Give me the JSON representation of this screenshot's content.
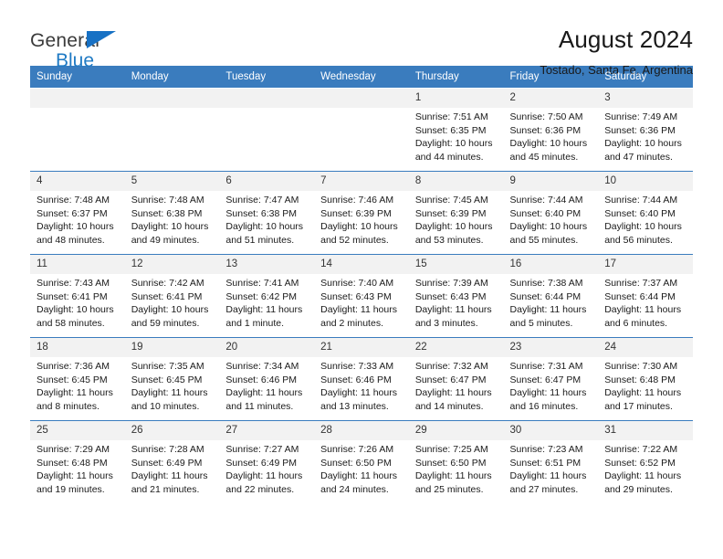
{
  "brand": {
    "name_top": "General",
    "name_bottom": "Blue",
    "triangle_color": "#1771c4",
    "text_color": "#3b3b3b",
    "blue_color": "#1f7ac4"
  },
  "header": {
    "title": "August 2024",
    "subtitle": "Tostado, Santa Fe, Argentina"
  },
  "calendar": {
    "header_bg": "#3a7cbe",
    "daynum_bg": "#f2f2f2",
    "weekdays": [
      "Sunday",
      "Monday",
      "Tuesday",
      "Wednesday",
      "Thursday",
      "Friday",
      "Saturday"
    ],
    "weeks": [
      [
        {
          "day": "",
          "sunrise": "",
          "sunset": "",
          "daylight": "",
          "empty": true
        },
        {
          "day": "",
          "sunrise": "",
          "sunset": "",
          "daylight": "",
          "empty": true
        },
        {
          "day": "",
          "sunrise": "",
          "sunset": "",
          "daylight": "",
          "empty": true
        },
        {
          "day": "",
          "sunrise": "",
          "sunset": "",
          "daylight": "",
          "empty": true
        },
        {
          "day": "1",
          "sunrise": "Sunrise: 7:51 AM",
          "sunset": "Sunset: 6:35 PM",
          "daylight": "Daylight: 10 hours and 44 minutes."
        },
        {
          "day": "2",
          "sunrise": "Sunrise: 7:50 AM",
          "sunset": "Sunset: 6:36 PM",
          "daylight": "Daylight: 10 hours and 45 minutes."
        },
        {
          "day": "3",
          "sunrise": "Sunrise: 7:49 AM",
          "sunset": "Sunset: 6:36 PM",
          "daylight": "Daylight: 10 hours and 47 minutes."
        }
      ],
      [
        {
          "day": "4",
          "sunrise": "Sunrise: 7:48 AM",
          "sunset": "Sunset: 6:37 PM",
          "daylight": "Daylight: 10 hours and 48 minutes."
        },
        {
          "day": "5",
          "sunrise": "Sunrise: 7:48 AM",
          "sunset": "Sunset: 6:38 PM",
          "daylight": "Daylight: 10 hours and 49 minutes."
        },
        {
          "day": "6",
          "sunrise": "Sunrise: 7:47 AM",
          "sunset": "Sunset: 6:38 PM",
          "daylight": "Daylight: 10 hours and 51 minutes."
        },
        {
          "day": "7",
          "sunrise": "Sunrise: 7:46 AM",
          "sunset": "Sunset: 6:39 PM",
          "daylight": "Daylight: 10 hours and 52 minutes."
        },
        {
          "day": "8",
          "sunrise": "Sunrise: 7:45 AM",
          "sunset": "Sunset: 6:39 PM",
          "daylight": "Daylight: 10 hours and 53 minutes."
        },
        {
          "day": "9",
          "sunrise": "Sunrise: 7:44 AM",
          "sunset": "Sunset: 6:40 PM",
          "daylight": "Daylight: 10 hours and 55 minutes."
        },
        {
          "day": "10",
          "sunrise": "Sunrise: 7:44 AM",
          "sunset": "Sunset: 6:40 PM",
          "daylight": "Daylight: 10 hours and 56 minutes."
        }
      ],
      [
        {
          "day": "11",
          "sunrise": "Sunrise: 7:43 AM",
          "sunset": "Sunset: 6:41 PM",
          "daylight": "Daylight: 10 hours and 58 minutes."
        },
        {
          "day": "12",
          "sunrise": "Sunrise: 7:42 AM",
          "sunset": "Sunset: 6:41 PM",
          "daylight": "Daylight: 10 hours and 59 minutes."
        },
        {
          "day": "13",
          "sunrise": "Sunrise: 7:41 AM",
          "sunset": "Sunset: 6:42 PM",
          "daylight": "Daylight: 11 hours and 1 minute."
        },
        {
          "day": "14",
          "sunrise": "Sunrise: 7:40 AM",
          "sunset": "Sunset: 6:43 PM",
          "daylight": "Daylight: 11 hours and 2 minutes."
        },
        {
          "day": "15",
          "sunrise": "Sunrise: 7:39 AM",
          "sunset": "Sunset: 6:43 PM",
          "daylight": "Daylight: 11 hours and 3 minutes."
        },
        {
          "day": "16",
          "sunrise": "Sunrise: 7:38 AM",
          "sunset": "Sunset: 6:44 PM",
          "daylight": "Daylight: 11 hours and 5 minutes."
        },
        {
          "day": "17",
          "sunrise": "Sunrise: 7:37 AM",
          "sunset": "Sunset: 6:44 PM",
          "daylight": "Daylight: 11 hours and 6 minutes."
        }
      ],
      [
        {
          "day": "18",
          "sunrise": "Sunrise: 7:36 AM",
          "sunset": "Sunset: 6:45 PM",
          "daylight": "Daylight: 11 hours and 8 minutes."
        },
        {
          "day": "19",
          "sunrise": "Sunrise: 7:35 AM",
          "sunset": "Sunset: 6:45 PM",
          "daylight": "Daylight: 11 hours and 10 minutes."
        },
        {
          "day": "20",
          "sunrise": "Sunrise: 7:34 AM",
          "sunset": "Sunset: 6:46 PM",
          "daylight": "Daylight: 11 hours and 11 minutes."
        },
        {
          "day": "21",
          "sunrise": "Sunrise: 7:33 AM",
          "sunset": "Sunset: 6:46 PM",
          "daylight": "Daylight: 11 hours and 13 minutes."
        },
        {
          "day": "22",
          "sunrise": "Sunrise: 7:32 AM",
          "sunset": "Sunset: 6:47 PM",
          "daylight": "Daylight: 11 hours and 14 minutes."
        },
        {
          "day": "23",
          "sunrise": "Sunrise: 7:31 AM",
          "sunset": "Sunset: 6:47 PM",
          "daylight": "Daylight: 11 hours and 16 minutes."
        },
        {
          "day": "24",
          "sunrise": "Sunrise: 7:30 AM",
          "sunset": "Sunset: 6:48 PM",
          "daylight": "Daylight: 11 hours and 17 minutes."
        }
      ],
      [
        {
          "day": "25",
          "sunrise": "Sunrise: 7:29 AM",
          "sunset": "Sunset: 6:48 PM",
          "daylight": "Daylight: 11 hours and 19 minutes."
        },
        {
          "day": "26",
          "sunrise": "Sunrise: 7:28 AM",
          "sunset": "Sunset: 6:49 PM",
          "daylight": "Daylight: 11 hours and 21 minutes."
        },
        {
          "day": "27",
          "sunrise": "Sunrise: 7:27 AM",
          "sunset": "Sunset: 6:49 PM",
          "daylight": "Daylight: 11 hours and 22 minutes."
        },
        {
          "day": "28",
          "sunrise": "Sunrise: 7:26 AM",
          "sunset": "Sunset: 6:50 PM",
          "daylight": "Daylight: 11 hours and 24 minutes."
        },
        {
          "day": "29",
          "sunrise": "Sunrise: 7:25 AM",
          "sunset": "Sunset: 6:50 PM",
          "daylight": "Daylight: 11 hours and 25 minutes."
        },
        {
          "day": "30",
          "sunrise": "Sunrise: 7:23 AM",
          "sunset": "Sunset: 6:51 PM",
          "daylight": "Daylight: 11 hours and 27 minutes."
        },
        {
          "day": "31",
          "sunrise": "Sunrise: 7:22 AM",
          "sunset": "Sunset: 6:52 PM",
          "daylight": "Daylight: 11 hours and 29 minutes."
        }
      ]
    ]
  }
}
